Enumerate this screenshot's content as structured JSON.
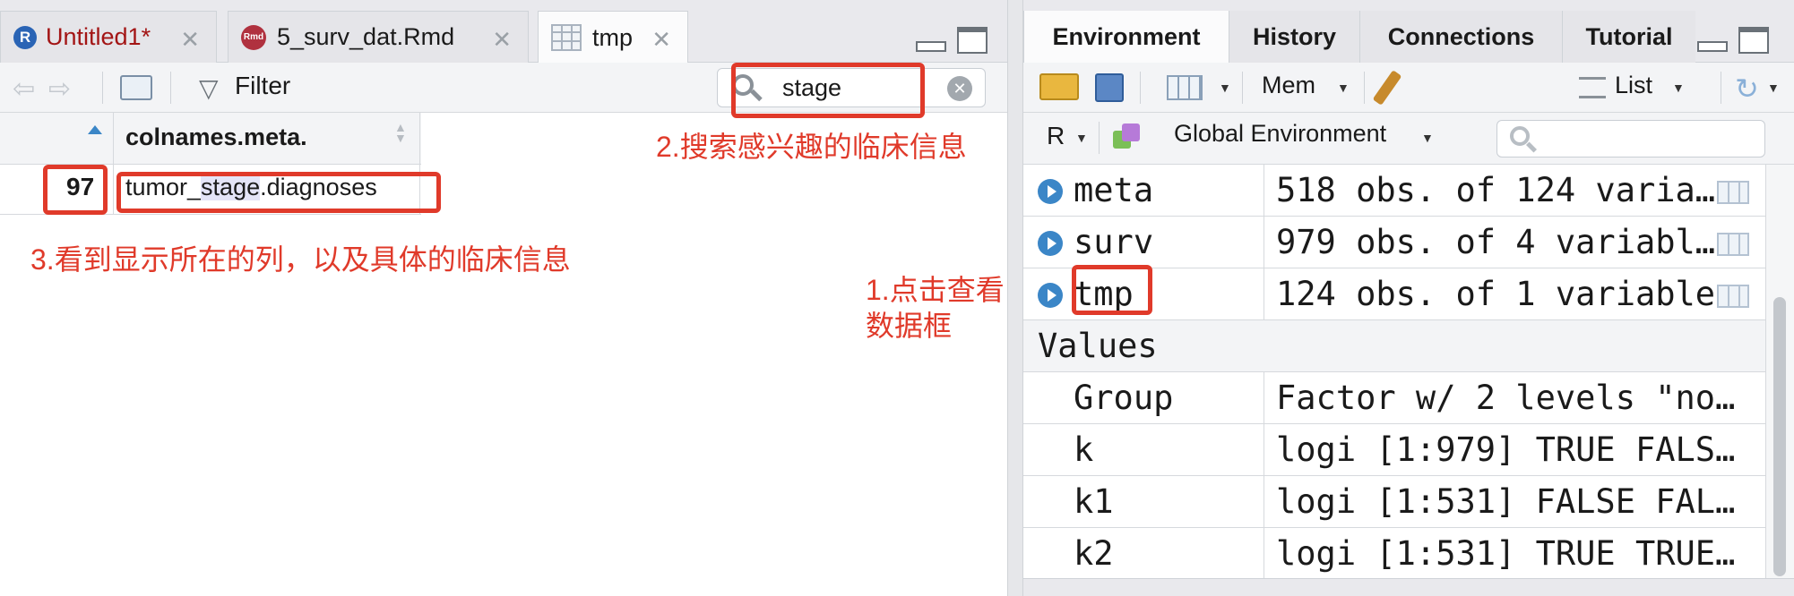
{
  "left_pane": {
    "tabs": [
      {
        "label": "Untitled1*",
        "icon": "r-file-icon",
        "color": "#a31515"
      },
      {
        "label": "5_surv_dat.Rmd",
        "icon": "rmd-file-icon"
      },
      {
        "label": "tmp",
        "icon": "table-icon",
        "active": true
      }
    ],
    "toolbar": {
      "filter_label": "Filter",
      "search_value": "stage"
    },
    "grid": {
      "columns": [
        "colnames.meta."
      ],
      "rows": [
        {
          "row_number": "97",
          "value_prefix": "tumor_",
          "value_match": "stage",
          "value_suffix": ".diagnoses"
        }
      ]
    }
  },
  "right_pane": {
    "tabs": [
      "Environment",
      "History",
      "Connections",
      "Tutorial"
    ],
    "toolbar": {
      "memory_label": "Mem",
      "view_label": "List"
    },
    "toolbar2": {
      "language": "R",
      "environment": "Global Environment"
    },
    "data_rows": [
      {
        "name": "meta",
        "value": "518 obs. of 124 varia…"
      },
      {
        "name": "surv",
        "value": "979 obs. of 4 variabl…"
      },
      {
        "name": "tmp",
        "value": "124 obs. of 1 variable"
      }
    ],
    "values_header": "Values",
    "value_rows": [
      {
        "name": "Group",
        "value": "Factor w/ 2 levels \"no…"
      },
      {
        "name": "k",
        "value": "logi [1:979] TRUE FALS…"
      },
      {
        "name": "k1",
        "value": "logi [1:531] FALSE FAL…"
      },
      {
        "name": "k2",
        "value": "logi [1:531] TRUE TRUE…"
      }
    ]
  },
  "annotations": {
    "step1_line1": "1.点击查看",
    "step1_line2": "数据框",
    "step2": "2.搜索感兴趣的临床信息",
    "step3": "3.看到显示所在的列，以及具体的临床信息"
  },
  "colors": {
    "annotation_red": "#e03a2a",
    "match_highlight": "#e4e4f7",
    "accent_blue": "#3b86c7"
  }
}
